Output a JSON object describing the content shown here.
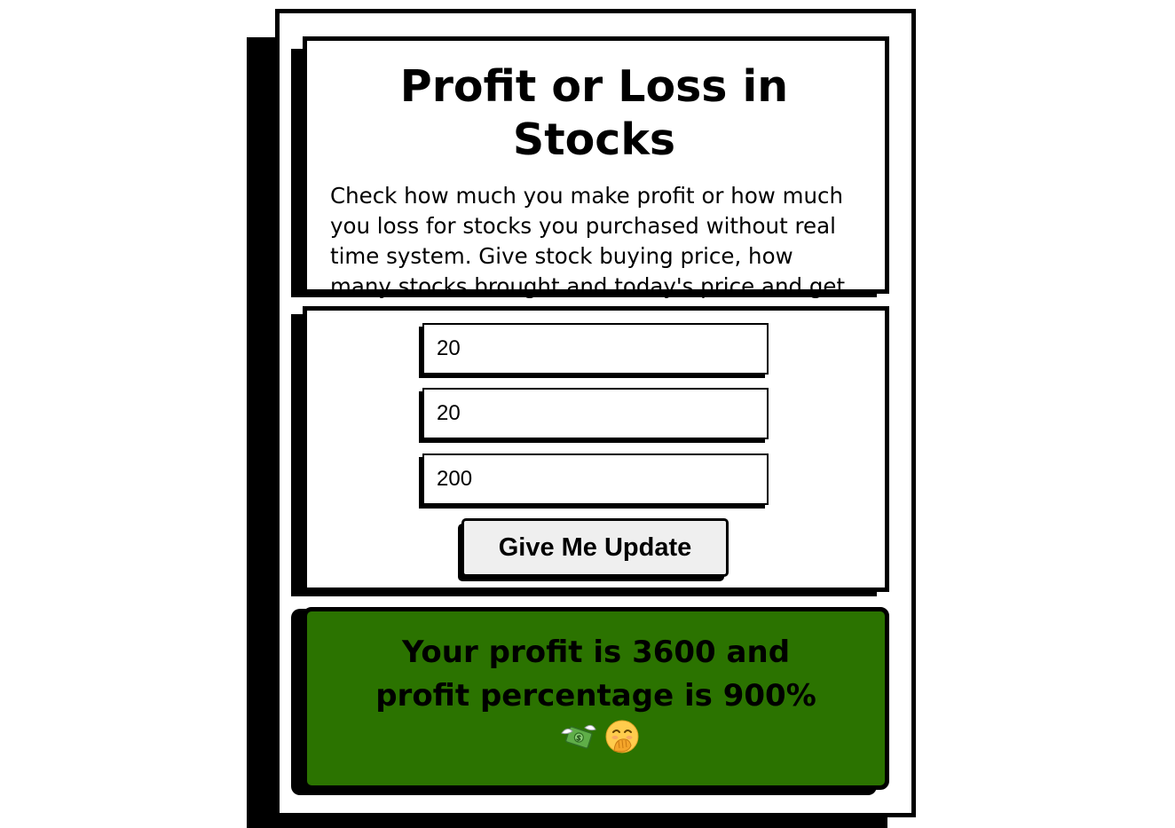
{
  "app": {
    "title": "Profit or Loss in Stocks",
    "description": "Check how much you make profit or how much you loss for stocks you purchased without real time system. Give stock buying price, how many stocks brought and today's price and get to know about your forecast."
  },
  "form": {
    "fields": [
      {
        "value": "20"
      },
      {
        "value": "20"
      },
      {
        "value": "200"
      }
    ],
    "submit_label": "Give Me Update"
  },
  "result": {
    "message": "Your profit is 3600 and profit percentage is 900%",
    "background_color": "#2b7300",
    "emojis": [
      "money-with-wings-icon",
      "hand-over-mouth-face-icon"
    ]
  }
}
